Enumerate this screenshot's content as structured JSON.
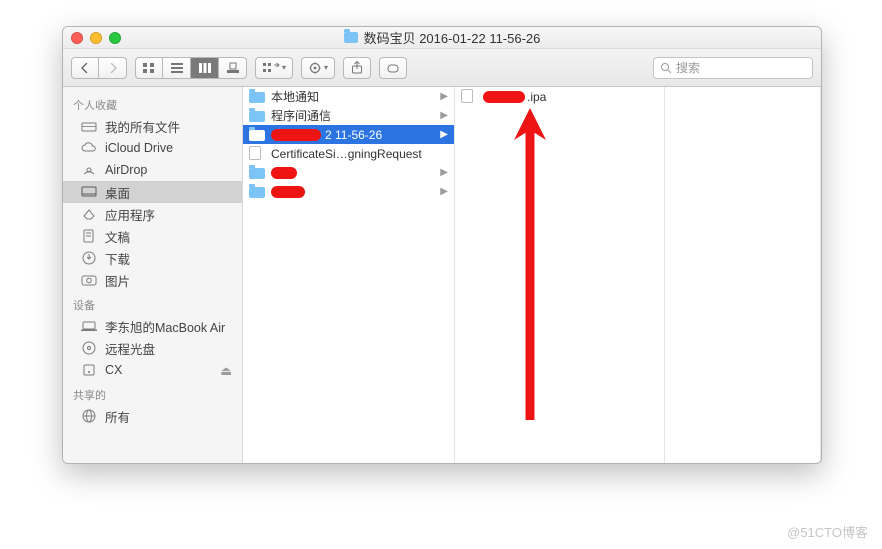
{
  "window": {
    "title": "数码宝贝 2016-01-22 11-56-26"
  },
  "search": {
    "placeholder": "搜索"
  },
  "sidebar": {
    "sections": [
      {
        "header": "个人收藏",
        "items": [
          {
            "label": "我的所有文件"
          },
          {
            "label": "iCloud Drive"
          },
          {
            "label": "AirDrop"
          },
          {
            "label": "桌面",
            "selected": true
          },
          {
            "label": "应用程序"
          },
          {
            "label": "文稿"
          },
          {
            "label": "下载"
          },
          {
            "label": "图片"
          }
        ]
      },
      {
        "header": "设备",
        "items": [
          {
            "label": "李东旭的MacBook Air"
          },
          {
            "label": "远程光盘"
          },
          {
            "label": "CX"
          }
        ]
      },
      {
        "header": "共享的",
        "items": [
          {
            "label": "所有"
          }
        ]
      }
    ]
  },
  "columns": {
    "c1": [
      {
        "type": "folder",
        "label": "本地通知",
        "chev": true
      },
      {
        "type": "folder",
        "label": "程序间通信",
        "chev": true
      },
      {
        "type": "folder",
        "label": "2 11-56-26",
        "chev": true,
        "selected": true,
        "redacted": true
      },
      {
        "type": "doc",
        "label": "CertificateSi…gningRequest"
      },
      {
        "type": "folder",
        "label": "",
        "chev": true,
        "redblob": true
      },
      {
        "type": "folder",
        "label": "",
        "chev": true,
        "redblob": true
      }
    ],
    "c2": [
      {
        "type": "doc",
        "label": ".ipa",
        "redacted": true
      }
    ]
  },
  "watermark": "@51CTO博客"
}
